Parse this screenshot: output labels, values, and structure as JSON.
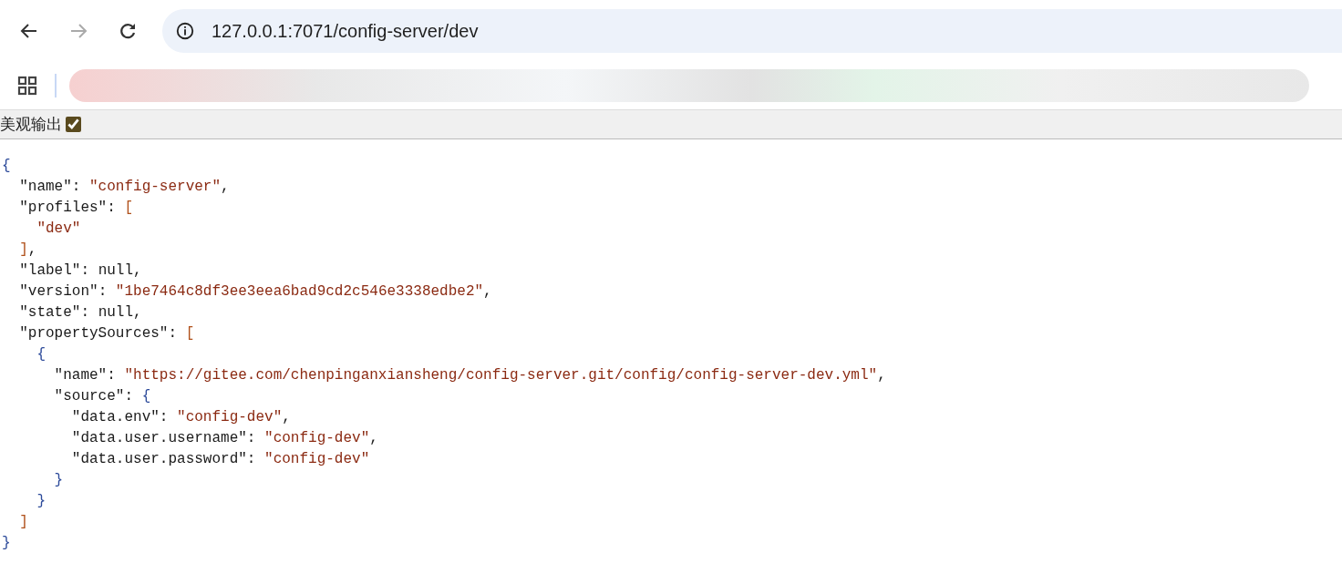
{
  "browser": {
    "url": "127.0.0.1:7071/config-server/dev",
    "forward_disabled": true
  },
  "pretty_print": {
    "label": "美观输出",
    "checked": true
  },
  "json_lines": [
    {
      "tokens": [
        {
          "kind": "brace",
          "text": "{"
        }
      ],
      "children": [
        {
          "tokens": [
            {
              "kind": "key",
              "text": "\"name\""
            },
            {
              "kind": "punct",
              "text": ": "
            },
            {
              "kind": "string",
              "text": "\"config-server\""
            },
            {
              "kind": "punct",
              "text": ","
            }
          ]
        },
        {
          "tokens": [
            {
              "kind": "key",
              "text": "\"profiles\""
            },
            {
              "kind": "punct",
              "text": ": "
            },
            {
              "kind": "bracket",
              "text": "["
            }
          ],
          "children": [
            {
              "tokens": [
                {
                  "kind": "string",
                  "text": "\"dev\""
                }
              ]
            }
          ]
        },
        {
          "tokens": [
            {
              "kind": "bracket",
              "text": "]"
            },
            {
              "kind": "punct",
              "text": ","
            }
          ]
        },
        {
          "tokens": [
            {
              "kind": "key",
              "text": "\"label\""
            },
            {
              "kind": "punct",
              "text": ": "
            },
            {
              "kind": "literal",
              "text": "null"
            },
            {
              "kind": "punct",
              "text": ","
            }
          ]
        },
        {
          "tokens": [
            {
              "kind": "key",
              "text": "\"version\""
            },
            {
              "kind": "punct",
              "text": ": "
            },
            {
              "kind": "string",
              "text": "\"1be7464c8df3ee3eea6bad9cd2c546e3338edbe2\""
            },
            {
              "kind": "punct",
              "text": ","
            }
          ]
        },
        {
          "tokens": [
            {
              "kind": "key",
              "text": "\"state\""
            },
            {
              "kind": "punct",
              "text": ": "
            },
            {
              "kind": "literal",
              "text": "null"
            },
            {
              "kind": "punct",
              "text": ","
            }
          ]
        },
        {
          "tokens": [
            {
              "kind": "key",
              "text": "\"propertySources\""
            },
            {
              "kind": "punct",
              "text": ": "
            },
            {
              "kind": "bracket",
              "text": "["
            }
          ],
          "children": [
            {
              "tokens": [
                {
                  "kind": "brace",
                  "text": "{"
                }
              ],
              "children": [
                {
                  "tokens": [
                    {
                      "kind": "key",
                      "text": "\"name\""
                    },
                    {
                      "kind": "punct",
                      "text": ": "
                    },
                    {
                      "kind": "string",
                      "text": "\"https://gitee.com/chenpinganxiansheng/config-server.git/config/config-server-dev.yml\""
                    },
                    {
                      "kind": "punct",
                      "text": ","
                    }
                  ]
                },
                {
                  "tokens": [
                    {
                      "kind": "key",
                      "text": "\"source\""
                    },
                    {
                      "kind": "punct",
                      "text": ": "
                    },
                    {
                      "kind": "brace",
                      "text": "{"
                    }
                  ],
                  "children": [
                    {
                      "tokens": [
                        {
                          "kind": "key",
                          "text": "\"data.env\""
                        },
                        {
                          "kind": "punct",
                          "text": ": "
                        },
                        {
                          "kind": "string",
                          "text": "\"config-dev\""
                        },
                        {
                          "kind": "punct",
                          "text": ","
                        }
                      ]
                    },
                    {
                      "tokens": [
                        {
                          "kind": "key",
                          "text": "\"data.user.username\""
                        },
                        {
                          "kind": "punct",
                          "text": ": "
                        },
                        {
                          "kind": "string",
                          "text": "\"config-dev\""
                        },
                        {
                          "kind": "punct",
                          "text": ","
                        }
                      ]
                    },
                    {
                      "tokens": [
                        {
                          "kind": "key",
                          "text": "\"data.user.password\""
                        },
                        {
                          "kind": "punct",
                          "text": ": "
                        },
                        {
                          "kind": "string",
                          "text": "\"config-dev\""
                        }
                      ]
                    }
                  ]
                },
                {
                  "tokens": [
                    {
                      "kind": "brace",
                      "text": "}"
                    }
                  ]
                }
              ]
            },
            {
              "tokens": [
                {
                  "kind": "brace",
                  "text": "}"
                }
              ]
            }
          ]
        },
        {
          "tokens": [
            {
              "kind": "bracket",
              "text": "]"
            }
          ]
        }
      ]
    },
    {
      "tokens": [
        {
          "kind": "brace",
          "text": "}"
        }
      ]
    }
  ]
}
